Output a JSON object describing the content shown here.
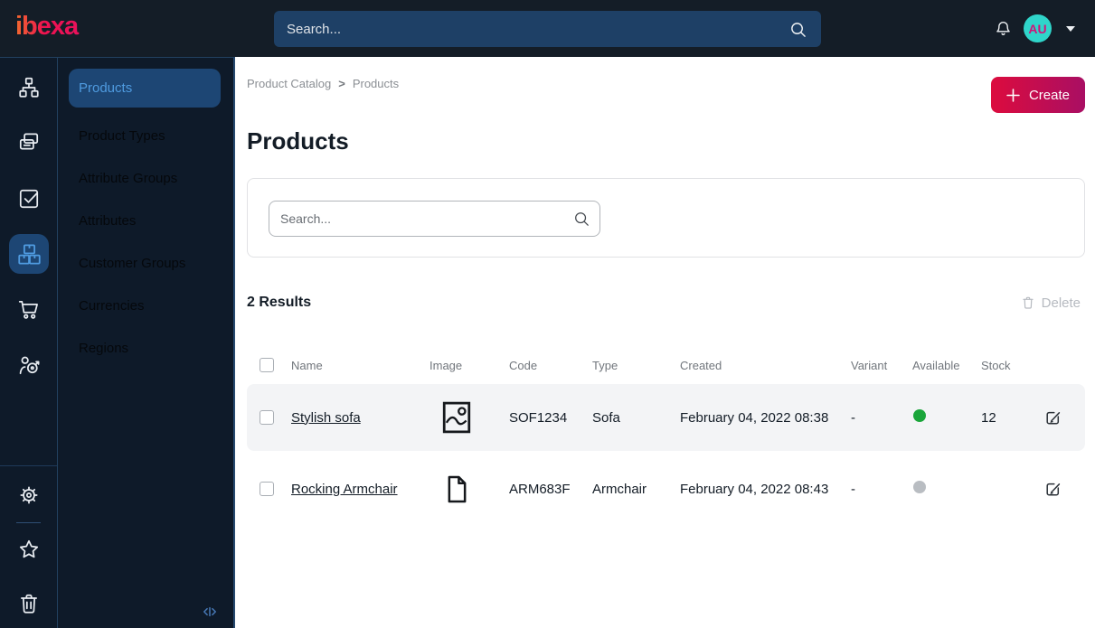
{
  "topbar": {
    "logo_text": "ibexa",
    "search_placeholder": "Search...",
    "user_initials": "AU"
  },
  "nav_strip": {
    "icons": [
      "content-tree-icon",
      "pages-icon",
      "tasks-icon",
      "product-catalog-icon",
      "commerce-cart-icon",
      "personalization-icon",
      "settings-gear-icon",
      "bookmarks-star-icon",
      "trash-icon"
    ],
    "active_icon": "product-catalog-icon"
  },
  "sidebar": {
    "items": [
      {
        "label": "Products",
        "active": true
      },
      {
        "label": "Product Types",
        "active": false
      },
      {
        "label": "Attribute Groups",
        "active": false
      },
      {
        "label": "Attributes",
        "active": false
      },
      {
        "label": "Customer Groups",
        "active": false
      },
      {
        "label": "Currencies",
        "active": false
      },
      {
        "label": "Regions",
        "active": false
      }
    ]
  },
  "breadcrumb": {
    "items": [
      "Product Catalog",
      "Products"
    ],
    "separator": ">"
  },
  "page": {
    "title": "Products"
  },
  "actions": {
    "create_label": "Create"
  },
  "filter": {
    "search_placeholder": "Search..."
  },
  "results": {
    "count_text": "2 Results",
    "delete_label": "Delete"
  },
  "table": {
    "columns": [
      "Name",
      "Image",
      "Code",
      "Type",
      "Created",
      "Variant",
      "Available",
      "Stock"
    ],
    "rows": [
      {
        "name": "Stylish sofa",
        "image_icon": "image-icon",
        "code": "SOF1234",
        "type": "Sofa",
        "created": "February 04, 2022 08:38",
        "variant": "-",
        "available": "yes",
        "stock": "12"
      },
      {
        "name": "Rocking Armchair",
        "image_icon": "file-icon",
        "code": "ARM683F",
        "type": "Armchair",
        "created": "February 04, 2022 08:43",
        "variant": "-",
        "available": "no",
        "stock": ""
      }
    ]
  },
  "colors": {
    "topbar_bg": "#141d27",
    "sidebar_bg": "#0e1a29",
    "active_item_bg": "#1d4674",
    "active_item_text": "#4f9be0",
    "create_gradient_start": "#dc0c3e",
    "create_gradient_end": "#a90e63",
    "available_green": "#1aa53a",
    "unavailable_grey": "#b9bdc2",
    "avatar_bg": "#2fd5ca",
    "avatar_text": "#cf1578"
  }
}
